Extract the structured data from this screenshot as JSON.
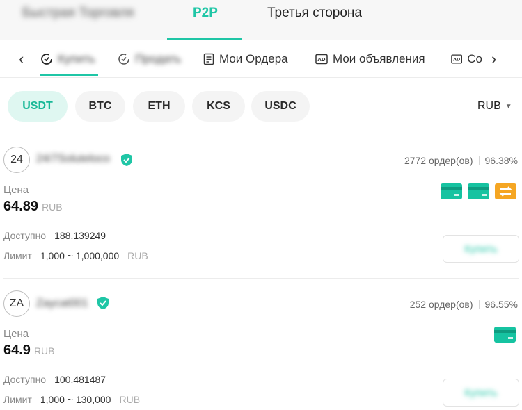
{
  "header": {
    "tabs": [
      {
        "label": "Быстрая Торговля"
      },
      {
        "label": "P2P"
      },
      {
        "label": "Третья сторона"
      }
    ]
  },
  "subnav": {
    "items": [
      {
        "label": "Купить",
        "icon": "buy-icon"
      },
      {
        "label": "Продать",
        "icon": "sell-icon"
      },
      {
        "label": "Мои Ордера",
        "icon": "orders-icon"
      },
      {
        "label": "Мои объявления",
        "icon": "ads-icon"
      },
      {
        "label": "Со",
        "icon": "ads-icon"
      }
    ],
    "left_arrow": "‹",
    "right_arrow": "›"
  },
  "coins": [
    "USDT",
    "BTC",
    "ETH",
    "KCS",
    "USDC"
  ],
  "currency": {
    "label": "RUB",
    "caret": "▼"
  },
  "listings": [
    {
      "avatar": "24",
      "username": "24/7Soluteloco",
      "orders": "2772 ордер(ов)",
      "completion": "96.38%",
      "price_label": "Цена",
      "price": "64.89",
      "price_currency": "RUB",
      "available_label": "Доступно",
      "available": "188.139249",
      "limit_label": "Лимит",
      "limit": "1,000 ~ 1,000,000",
      "limit_currency": "RUB",
      "buy_label": "Купить",
      "payments": [
        "card-icon",
        "card-icon",
        "transfer-icon"
      ]
    },
    {
      "avatar": "ZA",
      "username": "Zaycat001",
      "orders": "252 ордер(ов)",
      "completion": "96.55%",
      "price_label": "Цена",
      "price": "64.9",
      "price_currency": "RUB",
      "available_label": "Доступно",
      "available": "100.481487",
      "limit_label": "Лимит",
      "limit": "1,000 ~ 130,000",
      "limit_currency": "RUB",
      "buy_label": "Купить",
      "payments": [
        "card-icon"
      ]
    }
  ],
  "colors": {
    "accent": "#1fc6a6",
    "card_green": "#16c3a1",
    "transfer_orange": "#f5a623"
  }
}
